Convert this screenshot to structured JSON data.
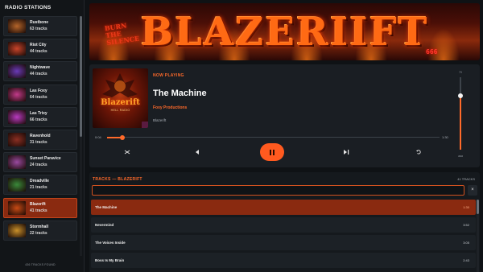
{
  "sidebar": {
    "title": "RADIO STATIONS",
    "footer": "436 TRACKS FOUND",
    "stations": [
      {
        "name": "Rustbone",
        "count": "63 tracks",
        "color": "#b5652a"
      },
      {
        "name": "Riot City",
        "count": "44 tracks",
        "color": "#c8442a"
      },
      {
        "name": "Nightwave",
        "count": "44 tracks",
        "color": "#6a3ab8"
      },
      {
        "name": "Las Foxy",
        "count": "64 tracks",
        "color": "#c23a8a"
      },
      {
        "name": "Las Trixy",
        "count": "66 tracks",
        "color": "#b83ac0"
      },
      {
        "name": "Ravenhold",
        "count": "31 tracks",
        "color": "#8a2e22"
      },
      {
        "name": "Sunset Paravice",
        "count": "24 tracks",
        "color": "#9a4aa0"
      },
      {
        "name": "Dreadville",
        "count": "21 tracks",
        "color": "#3a8a3a"
      },
      {
        "name": "Blazerift",
        "count": "41 tracks",
        "color": "#c84a14"
      },
      {
        "name": "Stormhall",
        "count": "22 tracks",
        "color": "#c8902a"
      }
    ],
    "active_index": 8
  },
  "banner": {
    "title": "BLAZERIIFT",
    "sign": "BURN THE SILENCE",
    "number": "666"
  },
  "player": {
    "now_label": "NOW PLAYING",
    "title": "The Machine",
    "artist": "Foxy Productions",
    "album": "Blazerift",
    "cover_title": "Blazerift",
    "cover_subtitle": "HELL RADIO",
    "time_current": "0:04",
    "time_total": "1:30",
    "progress": 0.045,
    "volume_max_label": "70",
    "volume_min_label": "aaa",
    "volume": 0.75,
    "icons": {
      "shuffle": "shuffle-icon",
      "previous": "previous-icon",
      "pause": "pause-icon",
      "next": "next-icon",
      "repeat": "repeat-icon"
    }
  },
  "tracks": {
    "header": "TRACKS — BLAZERIFT",
    "count": "41 TRACKS",
    "search_value": "",
    "search_placeholder": "",
    "clear_label": "×",
    "items": [
      {
        "title": "The Machine",
        "duration": "1:30"
      },
      {
        "title": "Nevermind",
        "duration": "3:52"
      },
      {
        "title": "The Voices Inside",
        "duration": "3:05"
      },
      {
        "title": "Boss Is My Brain",
        "duration": "2:43"
      }
    ],
    "active_index": 0
  },
  "colors": {
    "accent": "#ff6a2a",
    "active_row": "#8a2a10",
    "background": "#0f1215"
  }
}
